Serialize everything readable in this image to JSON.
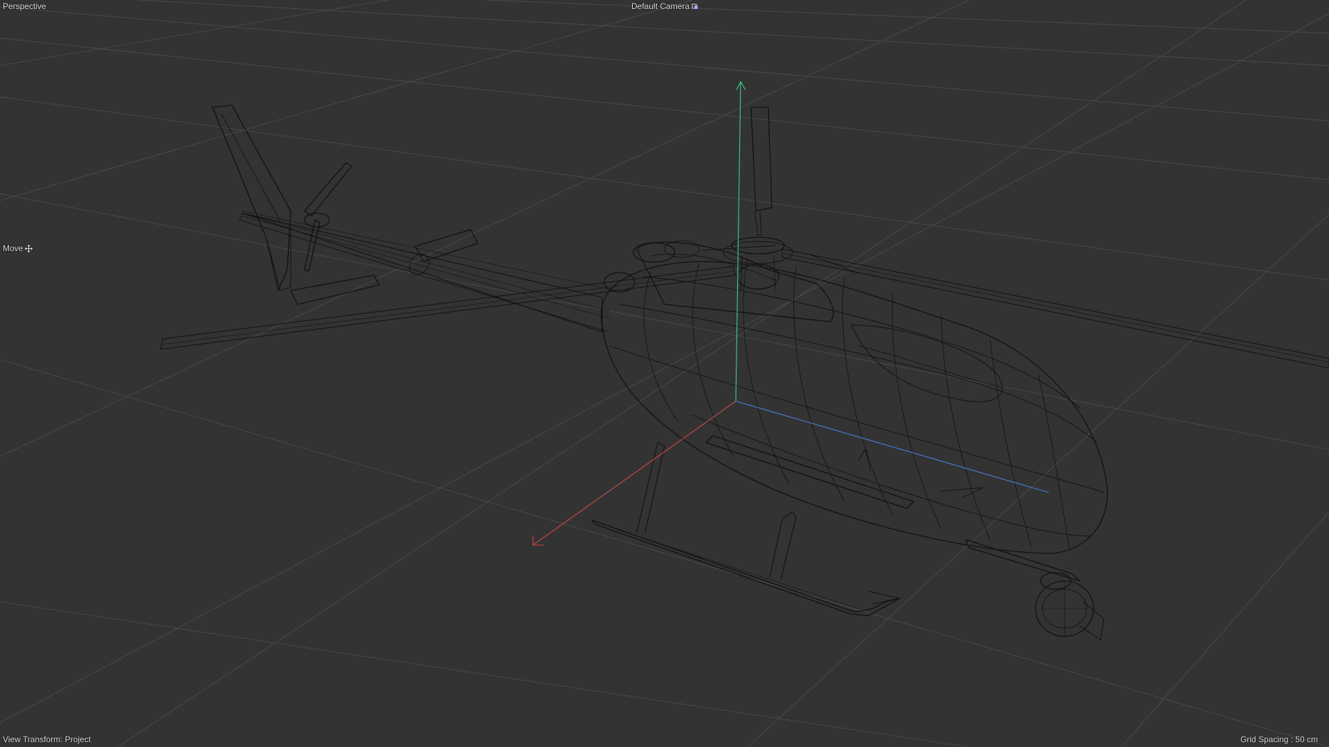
{
  "viewport": {
    "view_name": "Perspective",
    "camera": "Default Camera",
    "camera_icon": "camera-toggle-icon",
    "tool": "Move",
    "tool_icon": "move-cross-icon",
    "view_transform": "View Transform: Project",
    "grid_spacing": "Grid Spacing : 50 cm",
    "shading_mode": "wireframe",
    "object": "helicopter",
    "colors": {
      "background": "#333333",
      "grid": "#4a4a4a",
      "wire": "#111111",
      "axis_x": "#d04848",
      "axis_y": "#3fd08a",
      "axis_z": "#4a7fe0"
    }
  }
}
